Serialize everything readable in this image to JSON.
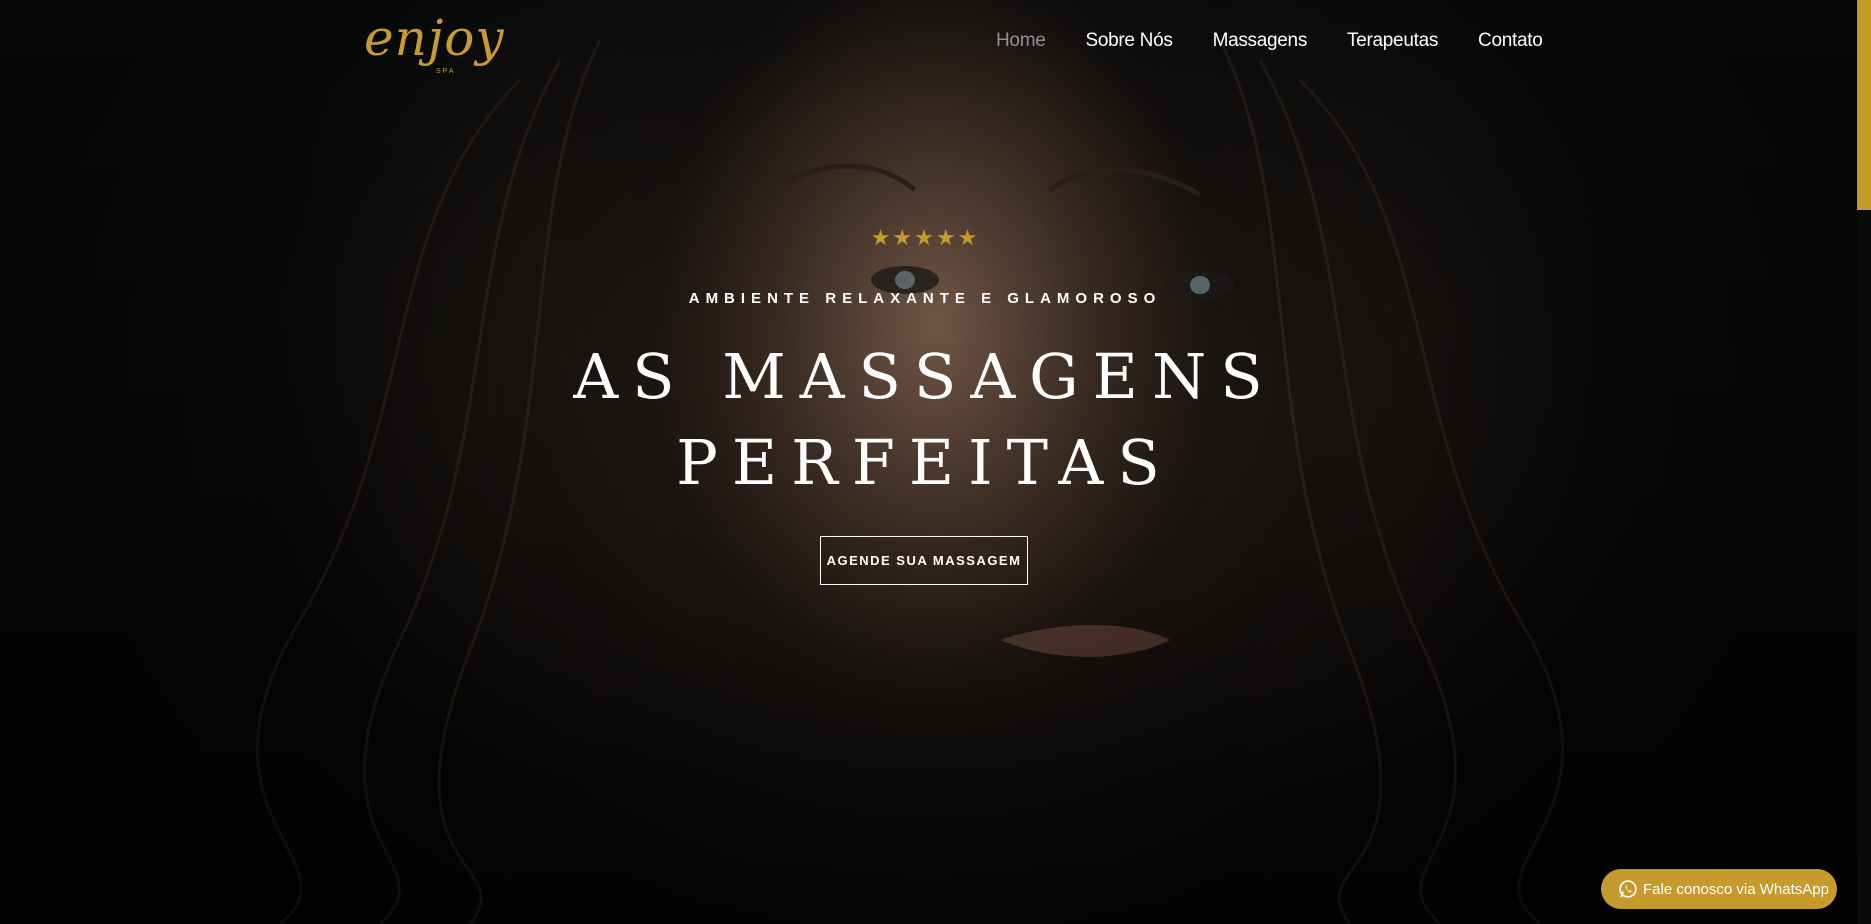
{
  "brand": {
    "logo_text": "enjoy",
    "logo_sub": "SPA",
    "accent_color": "#c59a2c"
  },
  "nav": {
    "items": [
      {
        "label": "Home",
        "active": true
      },
      {
        "label": "Sobre Nós"
      },
      {
        "label": "Massagens"
      },
      {
        "label": "Terapeutas"
      },
      {
        "label": "Contato"
      }
    ]
  },
  "hero": {
    "rating_stars": 5,
    "stars_text": "★★★★★",
    "kicker": "AMBIENTE RELAXANTE E GLAMOROSO",
    "headline_line1": "AS MASSAGENS",
    "headline_line2": "PERFEITAS",
    "cta_label": "AGENDE SUA MASSAGEM"
  },
  "whatsapp": {
    "icon": "whatsapp-icon",
    "label": "Fale conosco via WhatsApp"
  }
}
